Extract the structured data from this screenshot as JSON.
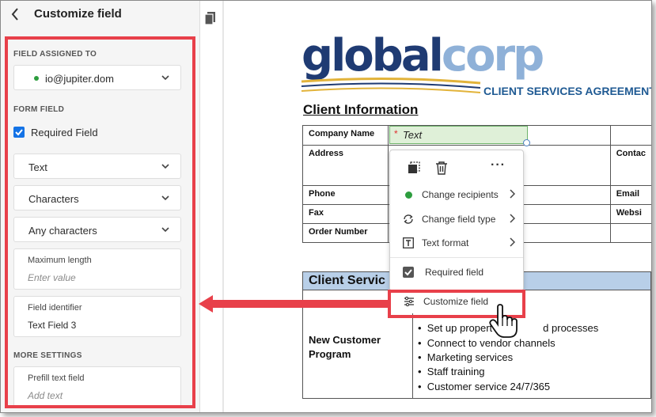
{
  "panel": {
    "title": "Customize field",
    "sections": {
      "field_assigned_to": "FIELD ASSIGNED TO",
      "form_field": "FORM FIELD",
      "more_settings": "MORE SETTINGS"
    },
    "assignee": "io@jupiter.dom",
    "required_field_label": "Required Field",
    "required_field_checked": true,
    "field_type": "Text",
    "validation": "Characters",
    "character_rule": "Any characters",
    "max_length": {
      "label": "Maximum length",
      "placeholder": "Enter value"
    },
    "field_identifier": {
      "label": "Field identifier",
      "value": "Text Field 3"
    },
    "prefill": {
      "label": "Prefill text field",
      "placeholder": "Add text"
    }
  },
  "document": {
    "logo_primary": "global",
    "logo_secondary": "corp",
    "agreement_title": "CLIENT SERVICES AGREEMENT",
    "client_info_heading": "Client Information",
    "rows": {
      "company_name": "Company Name",
      "address": "Address",
      "phone": "Phone",
      "fax": "Fax",
      "order_number": "Order Number",
      "contact": "Contac",
      "email": "Email",
      "website": "Websi"
    },
    "text_field_placeholder": "Text",
    "services_heading": "Client Servic",
    "new_customer_program": "New Customer Program",
    "bullets": [
      "Set up propert",
      "d processes",
      "Connect to vendor channels",
      "Marketing services",
      "Staff training",
      "Customer service 24/7/365"
    ]
  },
  "context_menu": {
    "items": [
      {
        "label": "Change recipients",
        "icon": "green-dot-icon"
      },
      {
        "label": "Change field type",
        "icon": "swap-icon"
      },
      {
        "label": "Text format",
        "icon": "text-format-icon"
      },
      {
        "label": "Required field",
        "icon": "checkbox-icon"
      },
      {
        "label": "Customize field",
        "icon": "sliders-icon"
      }
    ]
  },
  "colors": {
    "accent_blue": "#1473e6",
    "highlight_red": "#e8404a",
    "field_green": "#dff0d8",
    "logo_navy": "#1f3b73"
  }
}
